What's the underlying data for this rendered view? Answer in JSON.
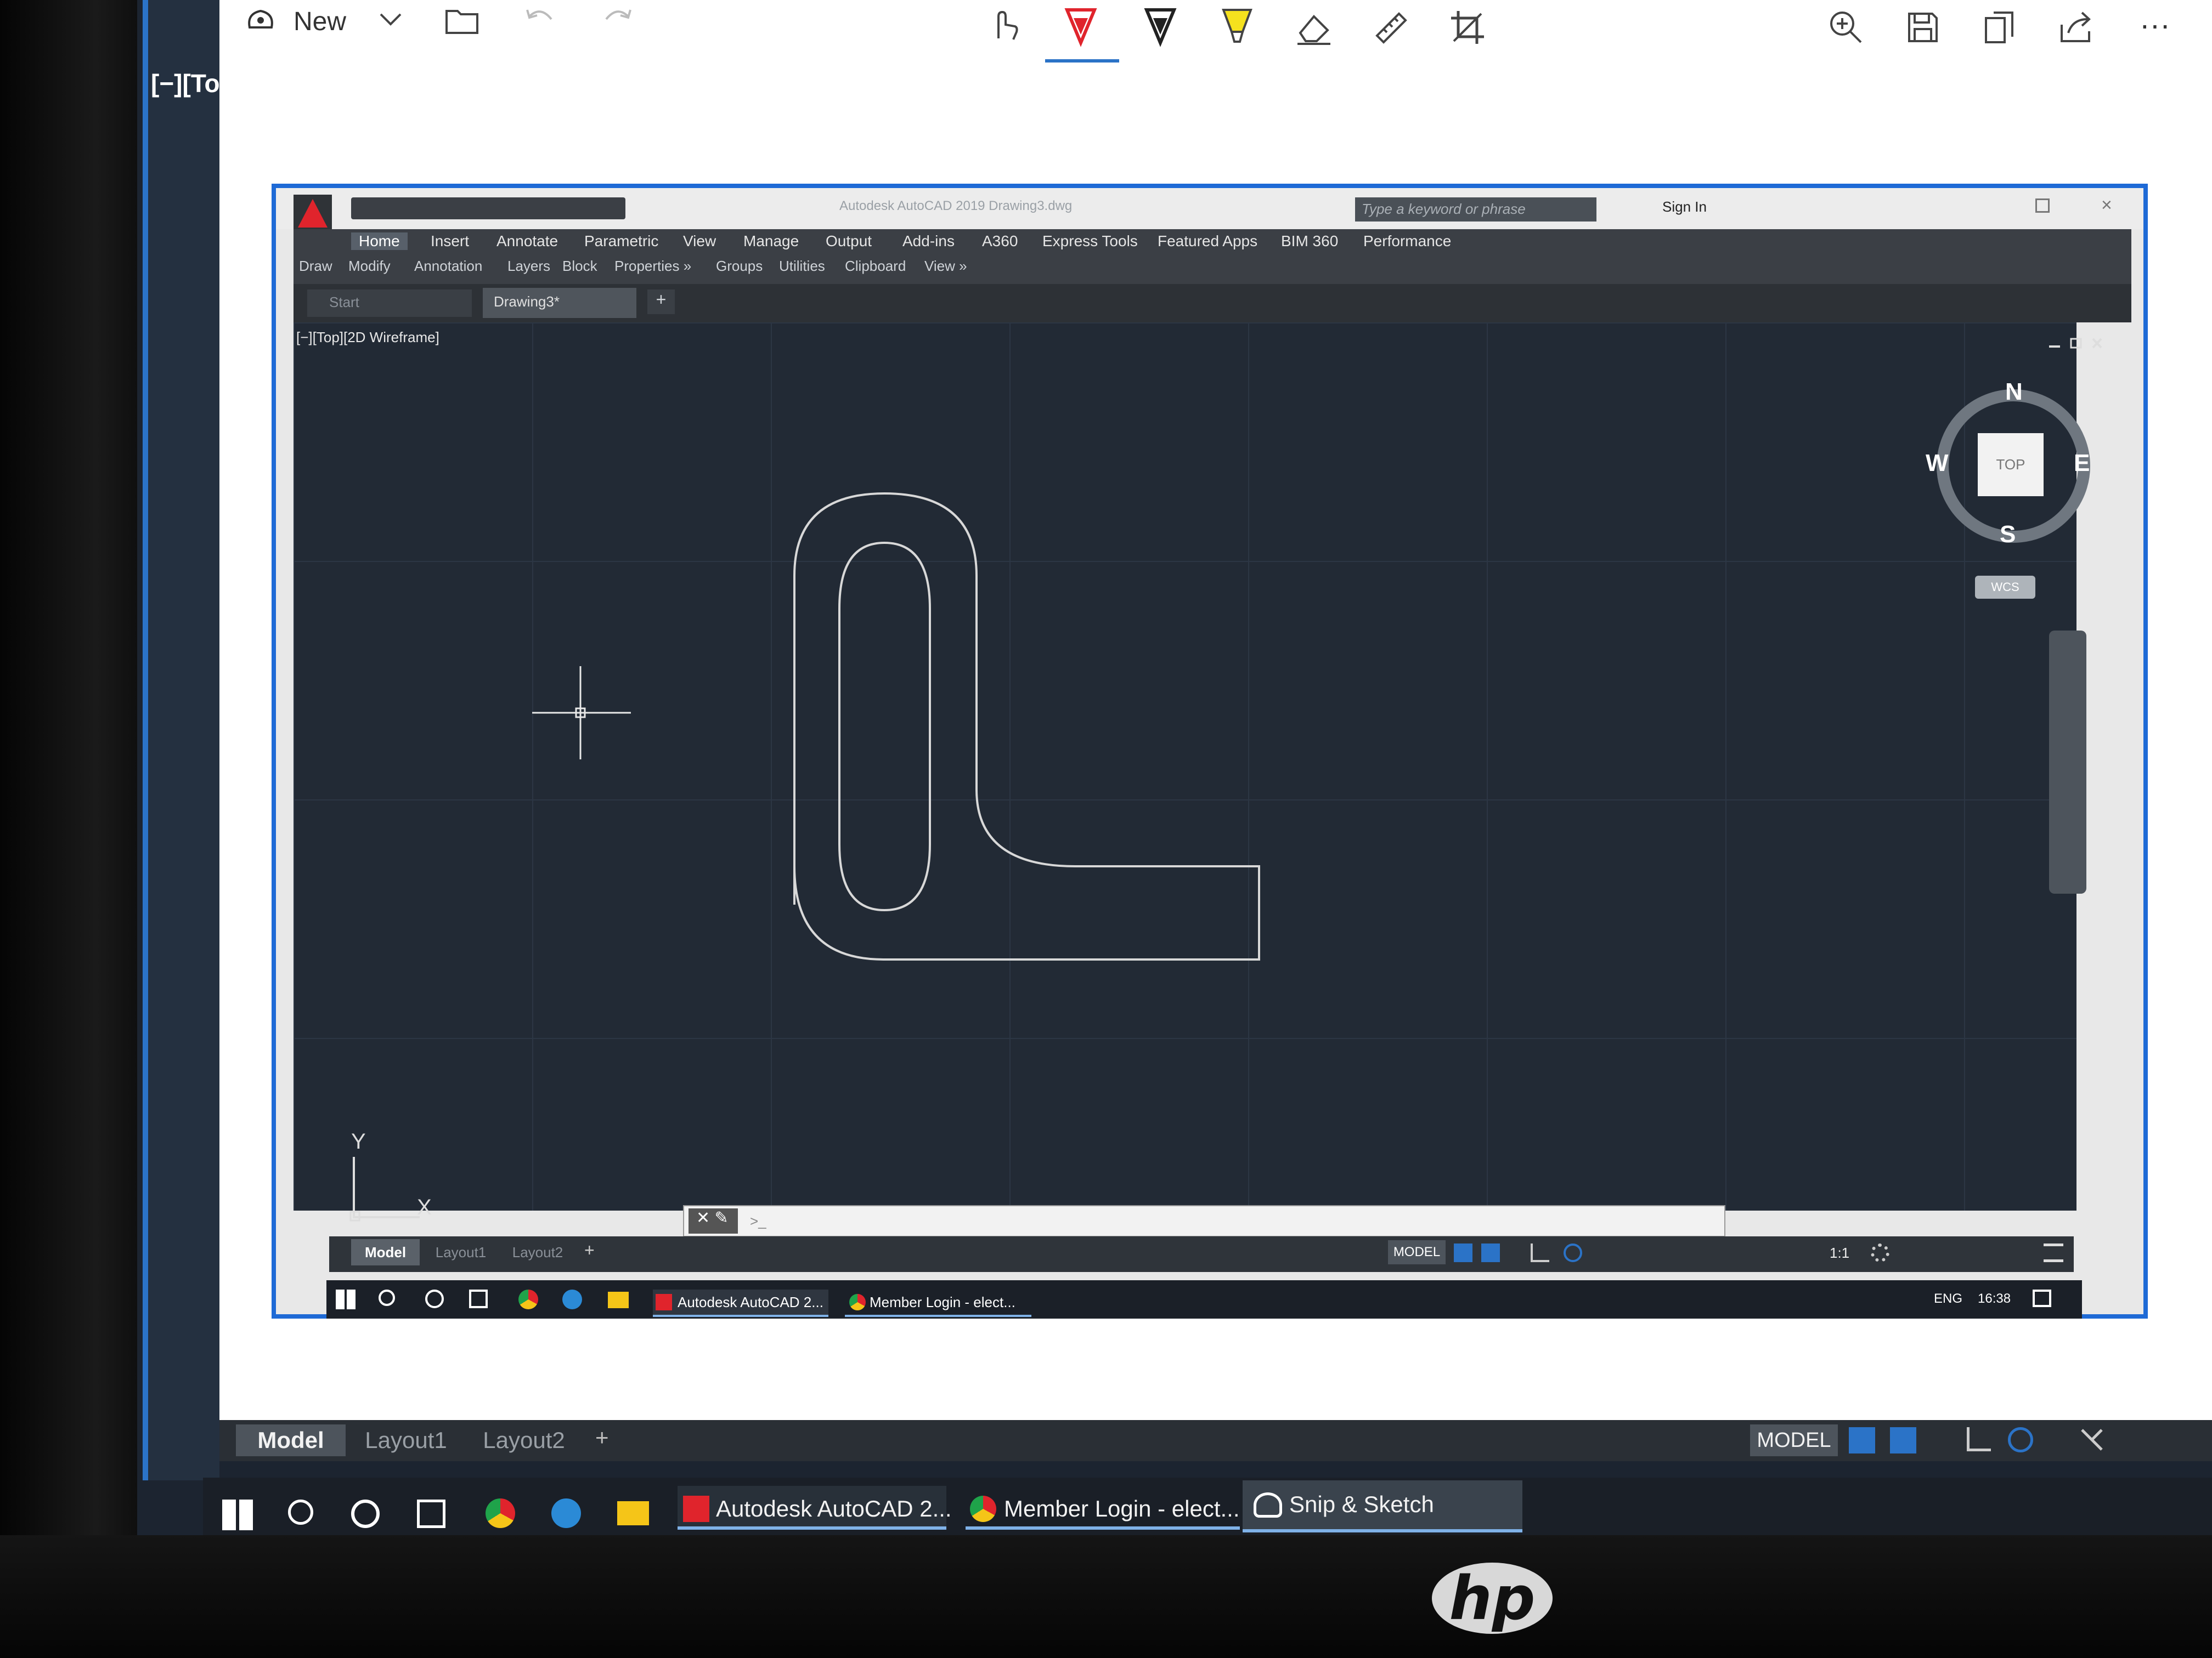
{
  "snip_toolbar": {
    "new_label": "New",
    "icons": [
      "touch-writing-icon",
      "ballpoint-pen-icon",
      "pencil-icon",
      "highlighter-icon",
      "eraser-icon",
      "ruler-icon",
      "crop-icon"
    ],
    "right_icons": [
      "zoom-icon",
      "save-icon",
      "copy-icon",
      "share-icon",
      "more-icon"
    ],
    "more_glyph": "···"
  },
  "back_viewport_label": "[−][To",
  "autocad": {
    "title": "Autodesk AutoCAD 2019   Drawing3.dwg",
    "search_placeholder": "Type a keyword or phrase",
    "sign_in": "Sign In",
    "ribbon_tabs": [
      "Home",
      "Insert",
      "Annotate",
      "Parametric",
      "View",
      "Manage",
      "Output",
      "Add-ins",
      "A360",
      "Express Tools",
      "Featured Apps",
      "BIM 360",
      "Performance"
    ],
    "ribbon_panels": [
      "Draw",
      "Modify",
      "Annotation",
      "Layers",
      "Block",
      "Properties »",
      "Groups",
      "Utilities",
      "Clipboard",
      "View »"
    ],
    "file_tabs": [
      "Start",
      "Drawing3*"
    ],
    "viewport_label": "[−][Top][2D Wireframe]",
    "viewcube": {
      "n": "N",
      "s": "S",
      "e": "E",
      "w": "W",
      "face": "TOP",
      "wcs": "WCS"
    },
    "ucs": {
      "x": "X",
      "y": "Y"
    },
    "command_prompt": ">_",
    "layout_tabs": [
      "Model",
      "Layout1",
      "Layout2"
    ],
    "status_model": "MODEL",
    "status_scale": "1:1",
    "taskbar_apps": [
      "Autodesk AutoCAD 2...",
      "Member Login - elect..."
    ],
    "tray_lang": "ENG",
    "tray_time": "16:38"
  },
  "outer": {
    "axis_y": "Y",
    "layout_tabs": [
      "Model",
      "Layout1",
      "Layout2"
    ],
    "status_model": "MODEL",
    "taskbar_apps": [
      "Autodesk AutoCAD 2...",
      "Member Login - elect...",
      "Snip & Sketch"
    ]
  },
  "brand": "hp"
}
